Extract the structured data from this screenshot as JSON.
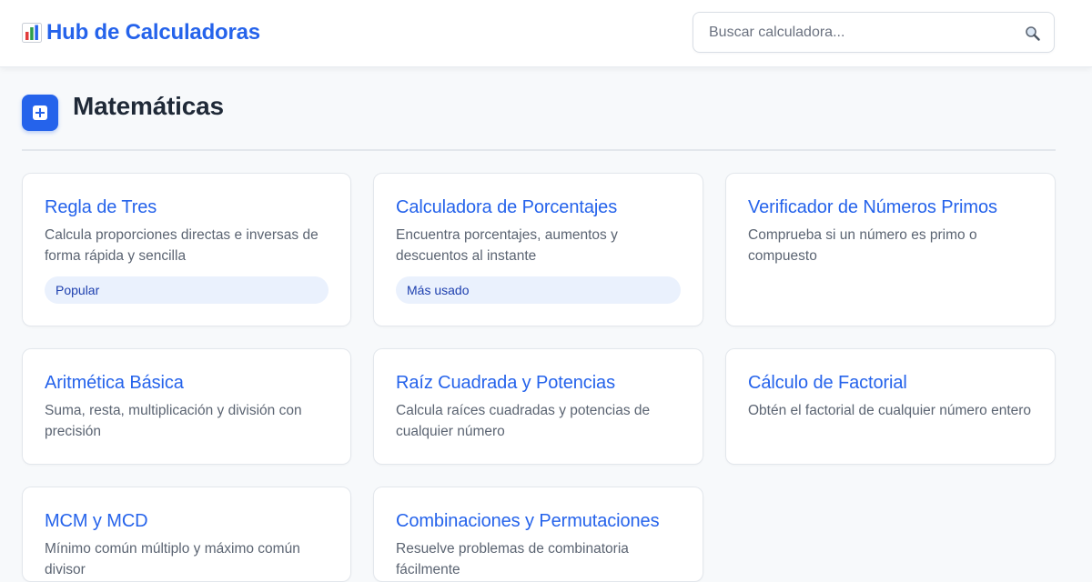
{
  "header": {
    "title": "Hub de Calculadoras",
    "brand_icon": "bar-chart-icon",
    "search": {
      "placeholder": "Buscar calculadora...",
      "value": "",
      "icon": "search-icon"
    }
  },
  "section": {
    "title": "Matemáticas",
    "icon": "plus-square-icon",
    "accent_color": "#2563eb"
  },
  "cards": [
    {
      "title": "Regla de Tres",
      "description": "Calcula proporciones directas e inversas de forma rápida y sencilla",
      "badge": "Popular"
    },
    {
      "title": "Calculadora de Porcentajes",
      "description": "Encuentra porcentajes, aumentos y descuentos al instante",
      "badge": "Más usado"
    },
    {
      "title": "Verificador de Números Primos",
      "description": "Comprueba si un número es primo o compuesto",
      "badge": ""
    },
    {
      "title": "Aritmética Básica",
      "description": "Suma, resta, multiplicación y división con precisión",
      "badge": ""
    },
    {
      "title": "Raíz Cuadrada y Potencias",
      "description": "Calcula raíces cuadradas y potencias de cualquier número",
      "badge": ""
    },
    {
      "title": "Cálculo de Factorial",
      "description": "Obtén el factorial de cualquier número entero",
      "badge": ""
    },
    {
      "title": "MCM y MCD",
      "description": "Mínimo común múltiplo y máximo común divisor",
      "badge": ""
    },
    {
      "title": "Combinaciones y Permutaciones",
      "description": "Resuelve problemas de combinatoria fácilmente",
      "badge": ""
    }
  ]
}
